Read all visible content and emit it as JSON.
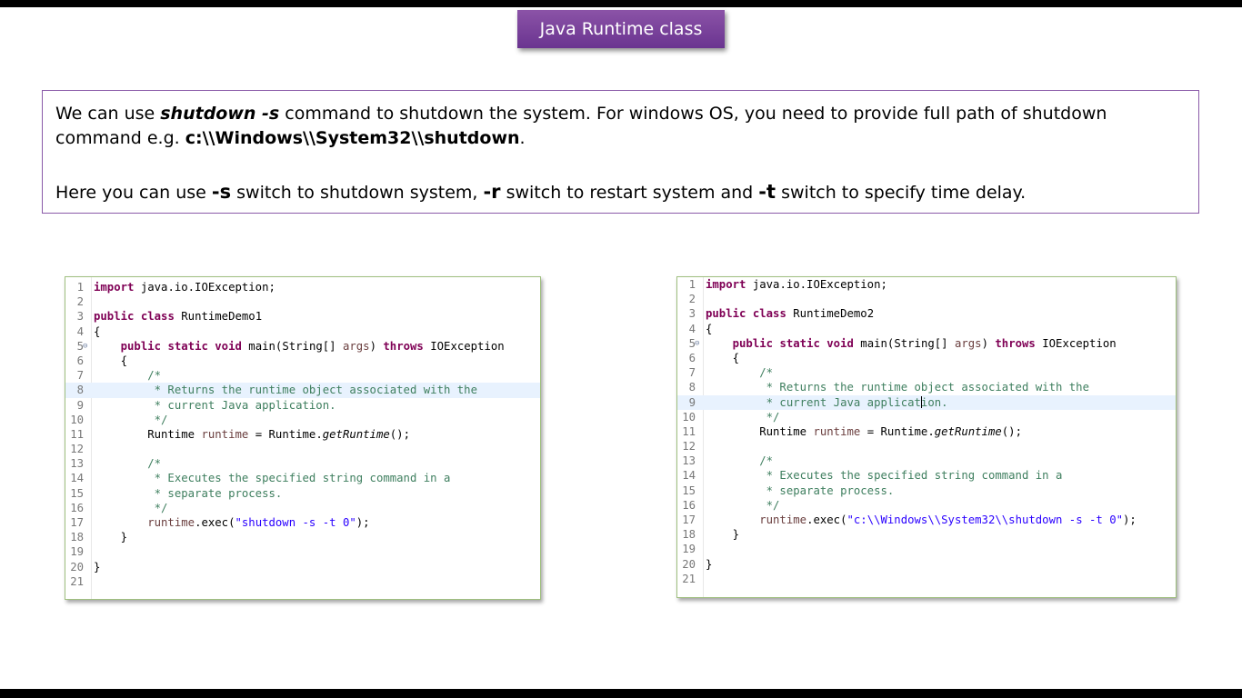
{
  "slide": {
    "title": "Java Runtime class"
  },
  "description": {
    "p1": {
      "t1": "We can use ",
      "cmd": "shutdown -s",
      "t2": " command to shutdown the system. For windows OS, you need to provide full path of shutdown command e.g. ",
      "path": "c:\\\\Windows\\\\System32\\\\shutdown",
      "t3": "."
    },
    "p2": {
      "t1": "Here you can use ",
      "s": "-s",
      "t2": " switch to shutdown system, ",
      "r": "-r",
      "t3": " switch to restart system and ",
      "t": "-t",
      "t4": " switch to specify time delay."
    }
  },
  "code1": {
    "l1": {
      "n": "1",
      "kw": "import",
      "rest": " java.io.IOException;"
    },
    "l2": {
      "n": "2"
    },
    "l3": {
      "n": "3",
      "kw1": "public",
      "kw2": "class",
      "rest": " RuntimeDemo1"
    },
    "l4": {
      "n": "4",
      "rest": "{"
    },
    "l5": {
      "n": "5",
      "fold": "⊖",
      "kw1": "public",
      "kw2": "static",
      "kw3": "void",
      "a": " main(String[] ",
      "var": "args",
      "b": ") ",
      "kw4": "throws",
      "c": " IOException"
    },
    "l6": {
      "n": "6",
      "rest": "    {"
    },
    "l7": {
      "n": "7",
      "cm": "        /*"
    },
    "l8": {
      "n": "8",
      "cm": "         * Returns the runtime object associated with the"
    },
    "l9": {
      "n": "9",
      "cm": "         * current Java application."
    },
    "l10": {
      "n": "10",
      "cm": "         */"
    },
    "l11": {
      "n": "11",
      "a": "        Runtime ",
      "var": "runtime",
      "b": " = Runtime.",
      "it": "getRuntime",
      "c": "();"
    },
    "l12": {
      "n": "12"
    },
    "l13": {
      "n": "13",
      "cm": "        /*"
    },
    "l14": {
      "n": "14",
      "cm": "         * Executes the specified string command in a"
    },
    "l15": {
      "n": "15",
      "cm": "         * separate process."
    },
    "l16": {
      "n": "16",
      "cm": "         */"
    },
    "l17": {
      "n": "17",
      "var": "        runtime",
      "a": ".exec(",
      "str": "\"shutdown -s -t 0\"",
      "b": ");"
    },
    "l18": {
      "n": "18",
      "rest": "    }"
    },
    "l19": {
      "n": "19"
    },
    "l20": {
      "n": "20",
      "rest": "}"
    },
    "l21": {
      "n": "21"
    }
  },
  "code2": {
    "l1": {
      "n": "1",
      "kw": "import",
      "rest": " java.io.IOException;"
    },
    "l2": {
      "n": "2"
    },
    "l3": {
      "n": "3",
      "kw1": "public",
      "kw2": "class",
      "rest": " RuntimeDemo2"
    },
    "l4": {
      "n": "4",
      "rest": "{"
    },
    "l5": {
      "n": "5",
      "fold": "⊖",
      "kw1": "public",
      "kw2": "static",
      "kw3": "void",
      "a": " main(String[] ",
      "var": "args",
      "b": ") ",
      "kw4": "throws",
      "c": " IOException"
    },
    "l6": {
      "n": "6",
      "rest": "    {"
    },
    "l7": {
      "n": "7",
      "cm": "        /*"
    },
    "l8": {
      "n": "8",
      "cm": "         * Returns the runtime object associated with the"
    },
    "l9": {
      "n": "9",
      "cm_a": "         * current Java applicat",
      "cm_b": "ion."
    },
    "l10": {
      "n": "10",
      "cm": "         */"
    },
    "l11": {
      "n": "11",
      "a": "        Runtime ",
      "var": "runtime",
      "b": " = Runtime.",
      "it": "getRuntime",
      "c": "();"
    },
    "l12": {
      "n": "12"
    },
    "l13": {
      "n": "13",
      "cm": "        /*"
    },
    "l14": {
      "n": "14",
      "cm": "         * Executes the specified string command in a"
    },
    "l15": {
      "n": "15",
      "cm": "         * separate process."
    },
    "l16": {
      "n": "16",
      "cm": "         */"
    },
    "l17": {
      "n": "17",
      "var": "        runtime",
      "a": ".exec(",
      "str": "\"c:\\\\Windows\\\\System32\\\\shutdown -s -t 0\"",
      "b": ");"
    },
    "l18": {
      "n": "18",
      "rest": "    }"
    },
    "l19": {
      "n": "19"
    },
    "l20": {
      "n": "20",
      "rest": "}"
    },
    "l21": {
      "n": "21"
    }
  }
}
